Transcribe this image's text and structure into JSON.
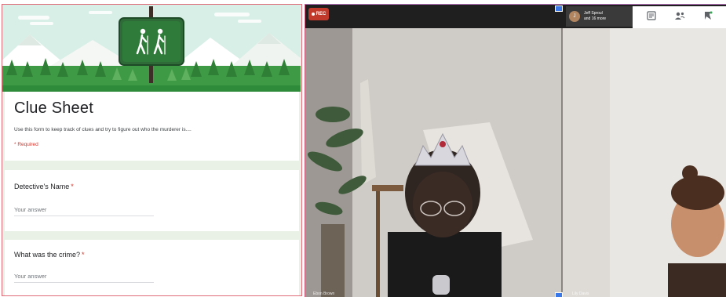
{
  "form": {
    "title": "Clue Sheet",
    "description": "Use this form to keep track of clues and try to figure out who the murderer is....",
    "required_note": "* Required",
    "questions": [
      {
        "label": "Detective's Name",
        "required_mark": "*",
        "answer_placeholder": "Your answer"
      },
      {
        "label": "What was the crime?",
        "required_mark": "*",
        "answer_placeholder": "Your answer"
      }
    ]
  },
  "banner": {
    "sign_icon": "hikers-icon"
  },
  "call": {
    "rec_label": "REC",
    "participants_chip": {
      "avatar_initial": "J",
      "line1": "Jeff Sproul",
      "line2": "and 16 more"
    },
    "toolbar_icons": [
      "chat-icon",
      "people-icon",
      "activities-icon"
    ],
    "tiles": [
      {
        "name": "Ebon Brown"
      },
      {
        "name": "Lily Davis"
      }
    ]
  },
  "colors": {
    "form_border": "#e06b78",
    "banner_green": "#2e8b3a",
    "required_red": "#d93025",
    "rec_red": "#c0392b"
  }
}
